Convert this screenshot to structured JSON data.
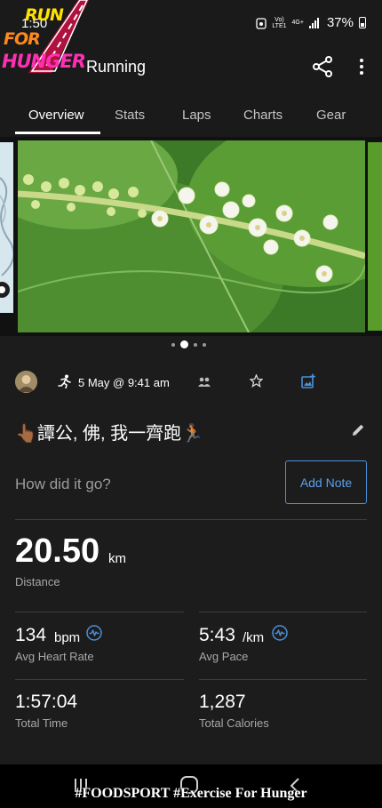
{
  "status": {
    "time": "1:50",
    "network_top": "Vo)",
    "network_bottom": "LTE1",
    "network_type": "4G+",
    "battery": "37%"
  },
  "logo": {
    "line1": "RUN",
    "line2": "FOR",
    "line3": "HUNGER"
  },
  "appbar": {
    "title": "Running"
  },
  "tabs": [
    {
      "label": "Overview",
      "active": true
    },
    {
      "label": "Stats"
    },
    {
      "label": "Laps"
    },
    {
      "label": "Charts"
    },
    {
      "label": "Gear"
    }
  ],
  "carousel": {
    "pages": 4,
    "active_page": 2
  },
  "activity": {
    "date": "5 May @ 9:41 am",
    "title": "👆🏾譚公, 佛, 我一齊跑🏃🏽",
    "feedback_prompt": "How did it go?",
    "add_note_label": "Add Note"
  },
  "stats": {
    "distance": {
      "value": "20.50",
      "unit": "km",
      "label": "Distance"
    },
    "heart_rate": {
      "value": "134",
      "unit": "bpm",
      "label": "Avg Heart Rate"
    },
    "pace": {
      "value": "5:43",
      "unit": "/km",
      "label": "Avg Pace"
    },
    "time": {
      "value": "1:57:04",
      "label": "Total Time"
    },
    "calories": {
      "value": "1,287",
      "label": "Total Calories"
    }
  },
  "caption": "#FOODSPORT #Exercise For Hunger",
  "colors": {
    "accent": "#4a90d9",
    "background": "#1c1c1c",
    "bar": "#1a1a1a"
  }
}
